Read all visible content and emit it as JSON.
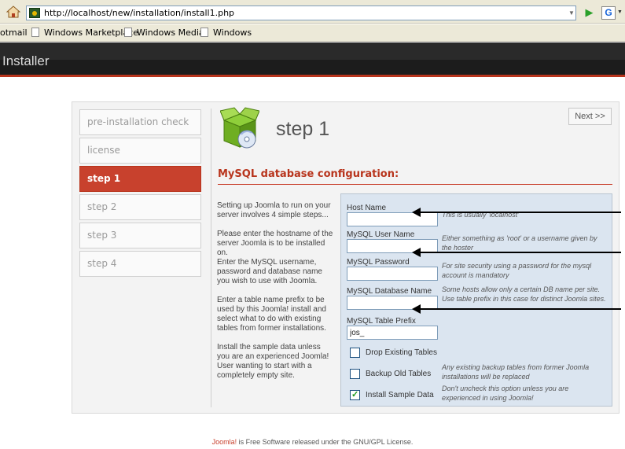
{
  "browser": {
    "url": "http://localhost/new/installation/install1.php",
    "bookmarks": [
      "otmail",
      "Windows Marketplace",
      "Windows Media",
      "Windows"
    ]
  },
  "header": {
    "title": "Installer"
  },
  "sidebar": {
    "items": [
      {
        "label": "pre-installation check",
        "active": false
      },
      {
        "label": "license",
        "active": false
      },
      {
        "label": "step 1",
        "active": true
      },
      {
        "label": "step 2",
        "active": false
      },
      {
        "label": "step 3",
        "active": false
      },
      {
        "label": "step 4",
        "active": false
      }
    ]
  },
  "main": {
    "next_label": "Next >>",
    "step_title": "step 1",
    "section_title": "MySQL database configuration:",
    "help": [
      "Setting up Joomla to run on your server involves 4 simple steps...",
      "Please enter the hostname of the server Joomla is to be installed on.",
      "Enter the MySQL username, password and database name you wish to use with Joomla.",
      "Enter a table name prefix to be used by this Joomla! install and select what to do with existing tables from former installations.",
      "Install the sample data unless you are an experienced Joomla! User wanting to start with a completely empty site."
    ],
    "fields": {
      "host": {
        "label": "Host Name",
        "value": "",
        "note": "This is usually 'localhost'"
      },
      "user": {
        "label": "MySQL User Name",
        "value": "",
        "note": "Either something as 'root' or a username given by the hoster"
      },
      "password": {
        "label": "MySQL Password",
        "value": "",
        "note": "For site security using a password for the mysql account is mandatory"
      },
      "database": {
        "label": "MySQL Database Name",
        "value": "",
        "note": "Some hosts allow only a certain DB name per site. Use table prefix in this case for distinct Joomla sites."
      },
      "prefix": {
        "label": "MySQL Table Prefix",
        "value": "jos_"
      }
    },
    "checks": {
      "drop": {
        "label": "Drop Existing Tables",
        "checked": false
      },
      "backup": {
        "label": "Backup Old Tables",
        "checked": false,
        "note": "Any existing backup tables from former Joomla installations will be replaced"
      },
      "sample": {
        "label": "Install Sample Data",
        "checked": true,
        "note": "Don't uncheck this option unless you are experienced in using Joomla!"
      }
    }
  },
  "footer": {
    "link": "Joomla!",
    "text": " is Free Software released under the GNU/GPL License."
  },
  "colors": {
    "accent": "#c8412d",
    "form_bg": "#dbe5f0",
    "header_bg": "#1c1c1c"
  }
}
